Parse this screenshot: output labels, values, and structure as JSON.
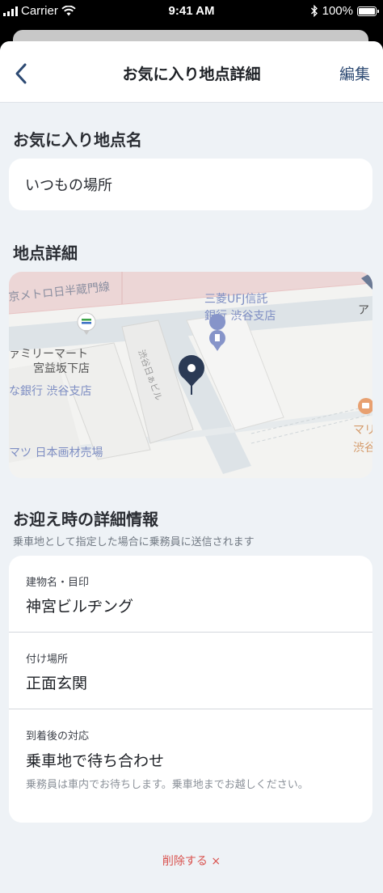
{
  "status": {
    "carrier": "Carrier",
    "time": "9:41 AM",
    "battery": "100%"
  },
  "nav": {
    "title": "お気に入り地点詳細",
    "edit_label": "編集",
    "back_icon": "chevron-left-icon"
  },
  "favorite": {
    "section_title": "お気に入り地点名",
    "name": "いつもの場所"
  },
  "location": {
    "section_title": "地点詳細",
    "map_labels": {
      "line": "京メトロ日半蔵門線",
      "bank_top1": "三菱UFJ信託",
      "bank_top2": "銀行 渋谷支店",
      "store1": "ァミリーマート",
      "store2": "宮益坂下店",
      "bank_left": "な銀行 渋谷支店",
      "building": "渋谷日ぁビル",
      "art": "マツ 日本画材売場",
      "right_edge": "ア",
      "right_cafe1": "マリ",
      "right_cafe2": "渋谷"
    }
  },
  "pickup": {
    "section_title": "お迎え時の詳細情報",
    "subtitle": "乗車地として指定した場合に乗務員に送信されます",
    "rows": [
      {
        "label": "建物名・目印",
        "value": "神宮ビルヂング"
      },
      {
        "label": "付け場所",
        "value": "正面玄関"
      },
      {
        "label": "到着後の対応",
        "value": "乗車地で待ち合わせ",
        "note": "乗務員は車内でお待ちします。乗車地までお越しください。"
      }
    ]
  },
  "delete_label": "削除する ×",
  "colors": {
    "accent": "#2d4a73",
    "pin": "#2b3a55",
    "danger": "#d9534f"
  }
}
